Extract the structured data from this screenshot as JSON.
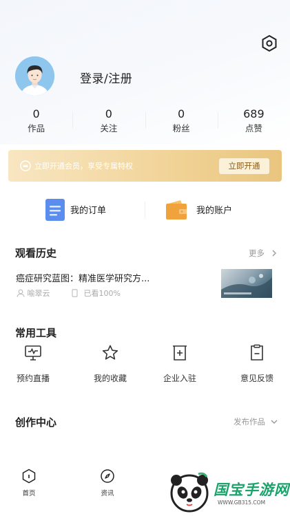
{
  "colors": {
    "accent_blue": "#5b8def",
    "accent_orange": "#f0a33c",
    "vip_gold": "#f1d397",
    "brand_green": "#1aa36b"
  },
  "profile": {
    "login_label": "登录/注册",
    "avatar_icon": "user-avatar",
    "settings_icon": "hexagon-settings-icon"
  },
  "stats": [
    {
      "value": "0",
      "label": "作品"
    },
    {
      "value": "0",
      "label": "关注"
    },
    {
      "value": "0",
      "label": "粉丝"
    },
    {
      "value": "689",
      "label": "点赞"
    }
  ],
  "vip": {
    "text": "立即开通会员，享受专属特权",
    "button": "立即开通",
    "icon": "crown-icon"
  },
  "accounts": [
    {
      "label": "我的订单",
      "icon": "order-document-icon"
    },
    {
      "label": "我的账户",
      "icon": "wallet-icon"
    }
  ],
  "history": {
    "title": "观看历史",
    "more": "更多",
    "item": {
      "title": "癌症研究蓝图：精准医学研究方...",
      "author": "喻翠云",
      "progress": "已看100%"
    }
  },
  "tools": {
    "title": "常用工具",
    "items": [
      {
        "label": "预约直播",
        "icon": "live-monitor-icon"
      },
      {
        "label": "我的收藏",
        "icon": "star-icon"
      },
      {
        "label": "企业入驻",
        "icon": "enterprise-plus-icon"
      },
      {
        "label": "意见反馈",
        "icon": "feedback-icon"
      }
    ]
  },
  "creation": {
    "title": "创作中心",
    "publish": "发布作品"
  },
  "tabbar": [
    {
      "label": "首页",
      "icon": "home-hexagon-icon"
    },
    {
      "label": "资讯",
      "icon": "compass-icon"
    }
  ],
  "watermark": {
    "text": "国宝手游网",
    "url": "WWW.GB315.COM"
  }
}
